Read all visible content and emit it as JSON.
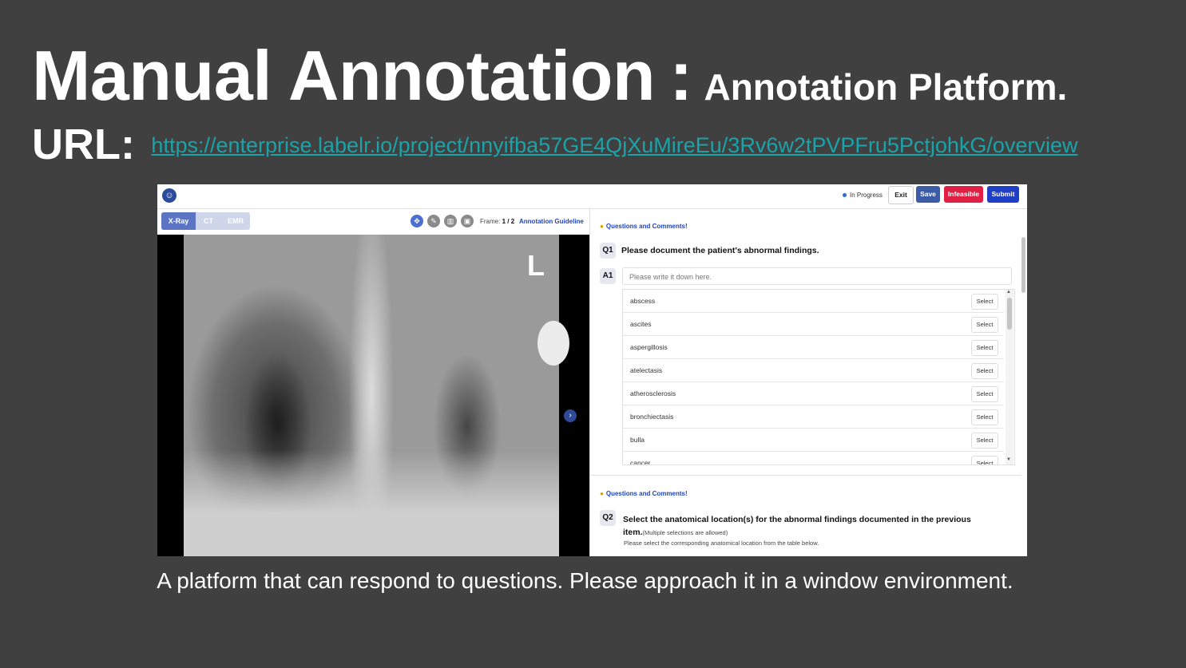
{
  "slide": {
    "title_main": "Manual Annotation",
    "title_sep": ":",
    "title_sub": "Annotation Platform.",
    "url_label": "URL:",
    "url": "https://enterprise.labelr.io/project/nnyifba57GE4QjXuMireEu/3Rv6w2tPVPFru5PctjohkG/overview",
    "caption": "A platform that can respond to questions. Please approach it in a window environment."
  },
  "app": {
    "status": "In Progress",
    "buttons": {
      "exit": "Exit",
      "save": "Save",
      "infeasible": "Infeasible",
      "submit": "Submit"
    },
    "tabs": [
      "X-Ray",
      "CT",
      "EMR"
    ],
    "active_tab": "X-Ray",
    "frame_label": "Frame:",
    "frame_value": "1 / 2",
    "guideline_link": "Annotation Guideline",
    "image_marker": "L",
    "icons": [
      "logo-icon",
      "move-icon",
      "pen-icon",
      "trash-icon",
      "view-icon",
      "next-arrow-icon",
      "comment-icon"
    ],
    "colors": {
      "accent": "#3d5ca8",
      "danger": "#e01f44",
      "submit": "#1f3fc4",
      "link": "#2044c0",
      "url": "#1aa3a8"
    }
  },
  "q1": {
    "comments_label": "Questions and Comments!",
    "number": "Q1",
    "question": "Please document the patient's abnormal findings.",
    "answer_number": "A1",
    "answer_placeholder": "Please write it down here.",
    "select_label": "Select",
    "options": [
      "abscess",
      "ascites",
      "aspergillosis",
      "atelectasis",
      "atherosclerosis",
      "bronchiectasis",
      "bulla",
      "cancer"
    ]
  },
  "q2": {
    "comments_label": "Questions and Comments!",
    "number": "Q2",
    "question_line1": "Select the anatomical location(s) for the abnormal findings documented in the previous",
    "question_line2": "item.",
    "note": "(Multiple selections are allowed)",
    "sub": "Please select the corresponding anatomical location from the table below."
  }
}
